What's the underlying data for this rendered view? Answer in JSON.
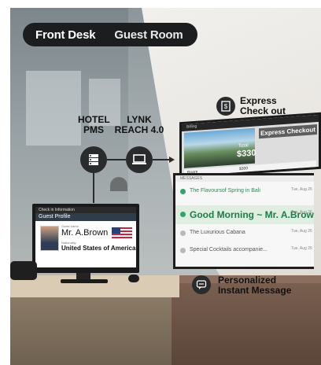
{
  "tabs": {
    "front_desk": "Front Desk",
    "guest_room": "Guest Room"
  },
  "pipeline": {
    "hotel_pms": [
      "HOTEL",
      "PMS"
    ],
    "lynk": [
      "LYNK",
      "REACH 4.0"
    ]
  },
  "monitor": {
    "topbar": "Check in Information",
    "title": "Guest Profile",
    "name_caption": "Guest name",
    "name": "Mr. A.Brown",
    "nationality_caption": "Nationality",
    "country": "United States of America"
  },
  "express": {
    "line1": "Express",
    "line2": "Check out"
  },
  "tv": {
    "topbar": "Billing",
    "button": "Express Checkout",
    "total_label": "Total",
    "total": "$330",
    "row_left": "Room",
    "row_right": "$300"
  },
  "messages": {
    "header": "MESSAGES",
    "items": [
      {
        "text": "The Flavoursof Spring in Bali",
        "date": "Tue, Aug 26"
      },
      {
        "text": "Good Morning ~ Mr. A.Brown",
        "date": "Tue, Aug 26"
      },
      {
        "text": "The Luxurious Cabana",
        "date": "Tue, Aug 26"
      },
      {
        "text": "Special Cocktails accompanie...",
        "date": "Tue, Aug 26"
      }
    ]
  },
  "personalized": {
    "line1": "Personalized",
    "line2": "Instant Message"
  },
  "colors": {
    "accent_green": "#2ea56b",
    "tab_bg": "#1c1d1f"
  },
  "icons": [
    "server-icon",
    "laptop-icon",
    "dollar-receipt-icon",
    "chat-bubble-icon"
  ]
}
